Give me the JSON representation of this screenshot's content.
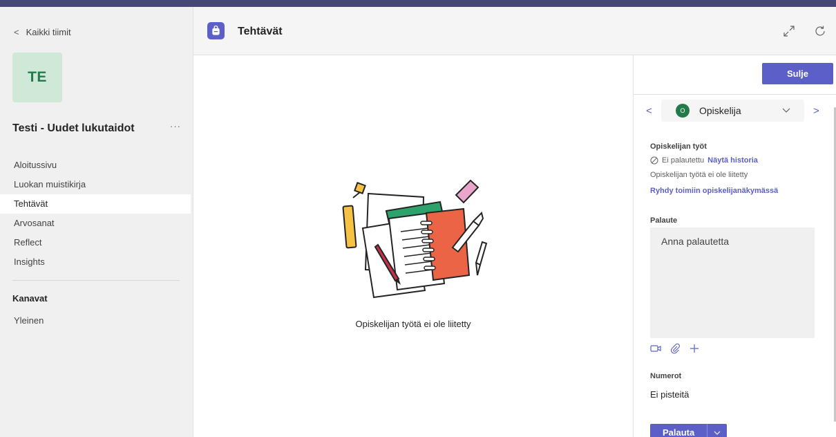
{
  "sidebar": {
    "back_label": "Kaikki tiimit",
    "team_initials": "TE",
    "team_name": "Testi - Uudet lukutaidot",
    "more_label": "···",
    "items": [
      {
        "label": "Aloitussivu"
      },
      {
        "label": "Luokan muistikirja"
      },
      {
        "label": "Tehtävät"
      },
      {
        "label": "Arvosanat"
      },
      {
        "label": "Reflect"
      },
      {
        "label": "Insights"
      }
    ],
    "active_item": "Tehtävät",
    "channels_heading": "Kanavat",
    "channels": [
      {
        "label": "Yleinen"
      }
    ]
  },
  "header": {
    "title": "Tehtävät",
    "icons": [
      "assignments-backpack-icon",
      "expand-icon",
      "refresh-icon"
    ]
  },
  "main": {
    "empty_message": "Opiskelijan työtä ei ole liitetty",
    "illustration": "notebook-stationery-illustration"
  },
  "panel": {
    "close_label": "Sulje",
    "student": {
      "initial": "O",
      "name": "Opiskelija"
    },
    "work": {
      "label": "Opiskelijan työt",
      "status": "Ei palautettu",
      "history_link": "Näytä historia",
      "not_attached": "Opiskelijan työtä ei ole liitetty",
      "student_view_link": "Ryhdy toimiin opiskelijanäkymässä"
    },
    "feedback": {
      "label": "Palaute",
      "placeholder": "Anna palautetta",
      "tools": [
        "video-icon",
        "attach-icon",
        "add-icon"
      ]
    },
    "points": {
      "label": "Numerot",
      "value": "Ei pisteitä"
    },
    "return_label": "Palauta"
  },
  "colors": {
    "brand": "#5b5fc7",
    "topbar": "#464775",
    "team_avatar_bg": "#cfe8d7",
    "team_avatar_fg": "#237b4b"
  }
}
